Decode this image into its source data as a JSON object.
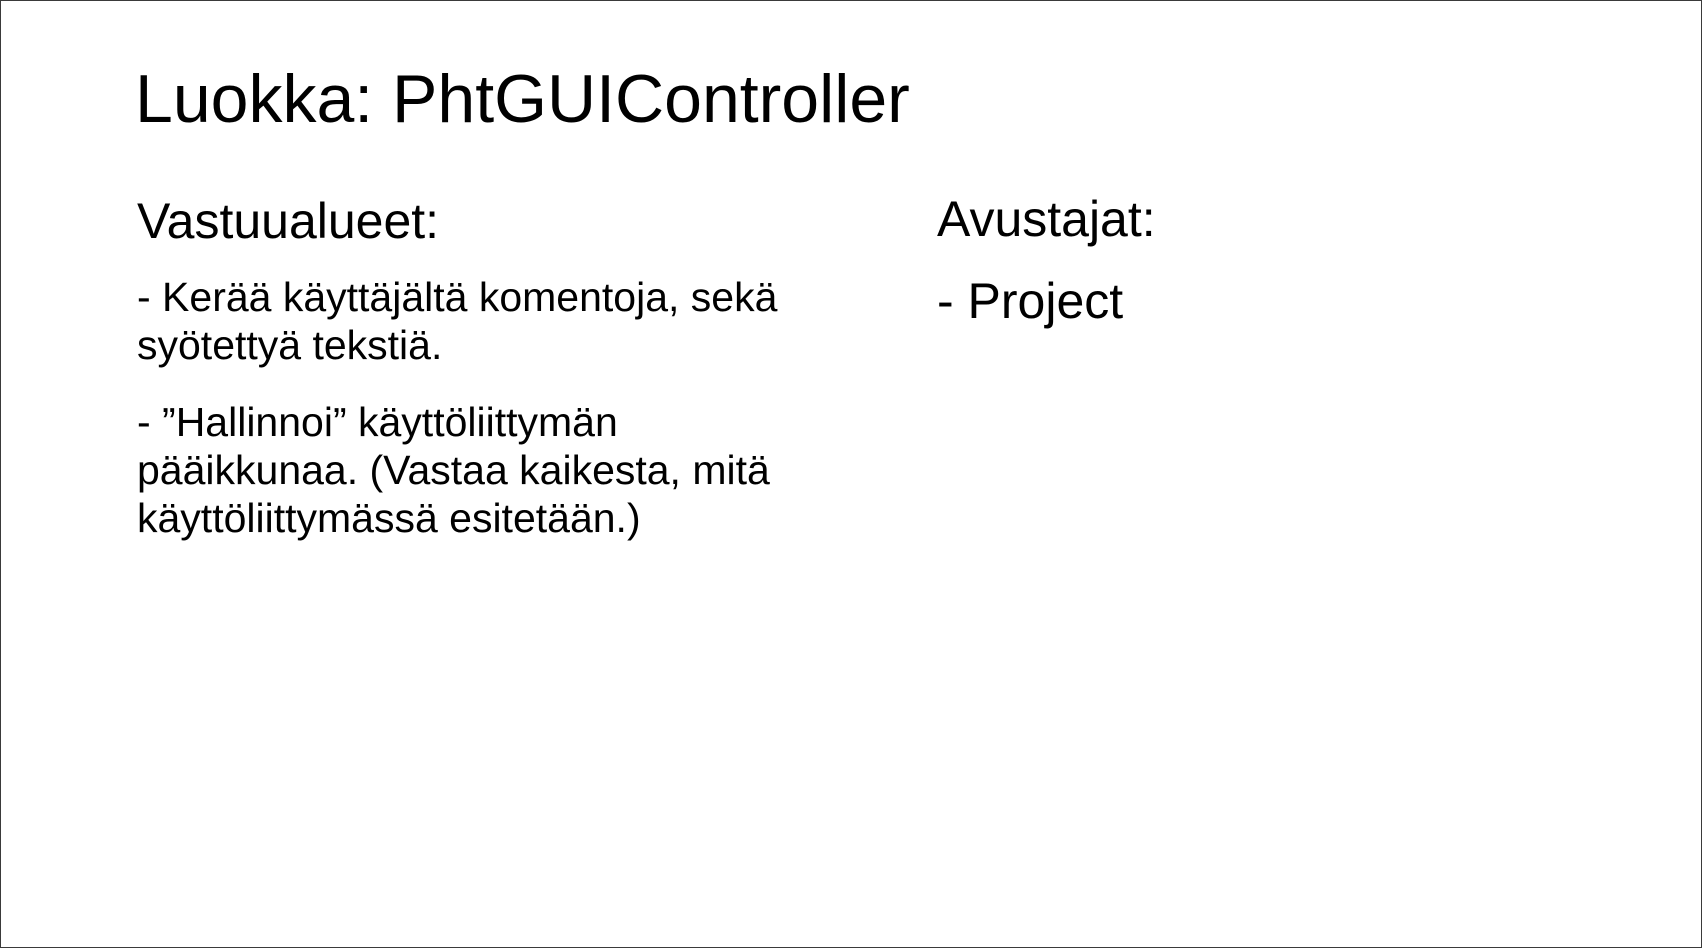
{
  "slide": {
    "title": "Luokka: PhtGUIController",
    "responsibilities": {
      "heading": "Vastuualueet:",
      "items": [
        "- Kerää käyttäjältä komentoja, sekä syötettyä tekstiä.",
        "- ”Hallinnoi” käyttöliittymän pääikkunaa. (Vastaa kaikesta, mitä käyttöliittymässä esitetään.)"
      ]
    },
    "collaborators": {
      "heading": "Avustajat:",
      "items": [
        "- Project"
      ]
    }
  }
}
